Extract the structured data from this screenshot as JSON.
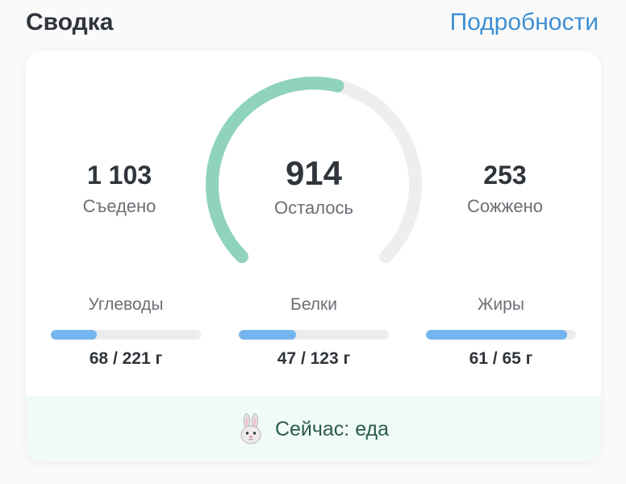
{
  "header": {
    "title": "Сводка",
    "details_link": "Подробности"
  },
  "summary": {
    "eaten": {
      "value": "1 103",
      "label": "Съедено"
    },
    "remaining": {
      "value": "914",
      "label": "Осталось"
    },
    "burned": {
      "value": "253",
      "label": "Сожжено"
    },
    "gauge_progress": 0.55
  },
  "macros": [
    {
      "label": "Углеводы",
      "current": 68,
      "goal": 221,
      "text": "68 / 221 г"
    },
    {
      "label": "Белки",
      "current": 47,
      "goal": 123,
      "text": "47 / 123 г"
    },
    {
      "label": "Жиры",
      "current": 61,
      "goal": 65,
      "text": "61 / 65 г"
    }
  ],
  "footer": {
    "status": "Сейчас: еда",
    "icon": "rabbit-icon"
  },
  "colors": {
    "gauge_fill": "#8fd3bd",
    "gauge_track": "#eeeeee",
    "bar_fill": "#74b5ef",
    "bar_track": "#ececec",
    "link": "#3e8fd3",
    "footer_bg": "#f0faf7"
  }
}
